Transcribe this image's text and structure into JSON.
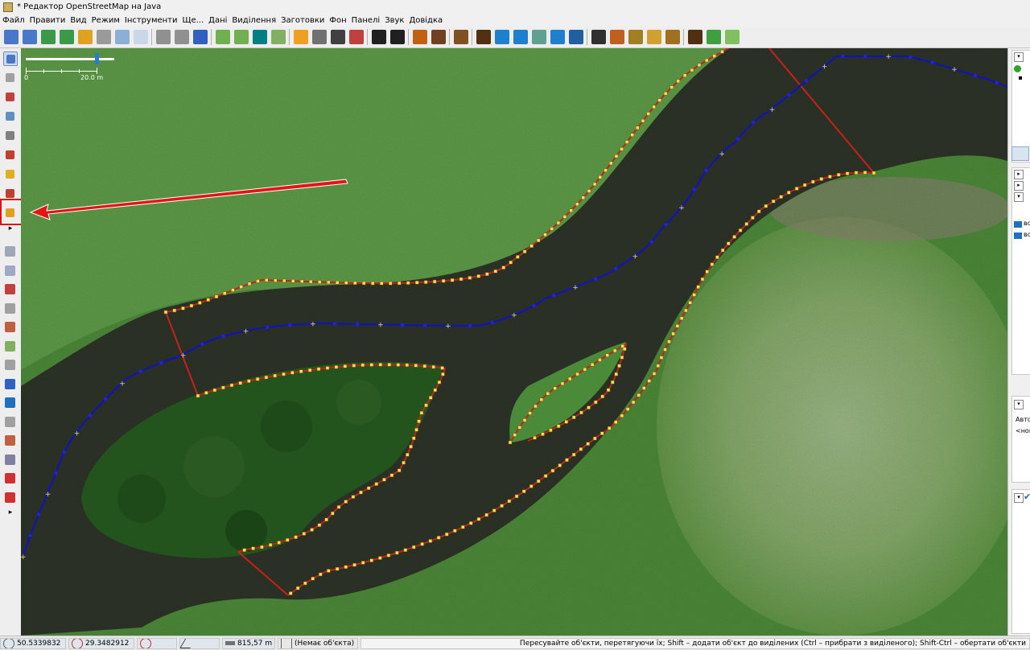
{
  "window": {
    "title": "* Редактор OpenStreetMap на Java"
  },
  "menu": [
    "Файл",
    "Правити",
    "Вид",
    "Режим",
    "Інструменти",
    "Ще...",
    "Дані",
    "Виділення",
    "Заготовки",
    "Фон",
    "Панелі",
    "Звук",
    "Довідка"
  ],
  "toolbar": {
    "icons": [
      "new-layer-icon",
      "open-file-icon",
      "download-icon",
      "upload-icon",
      "undo-icon",
      "redo-icon",
      "zoom-to-selection-icon",
      "preferences-icon",
      "sep",
      "split-way-icon",
      "combine-way-icon",
      "reverse-way-icon",
      "sep",
      "imagery-icon",
      "search-imagery-icon",
      "bing-icon",
      "imagery-offset-icon",
      "sep",
      "road-icon",
      "railway-icon",
      "traffic-signal-icon",
      "barrier-icon",
      "sep",
      "car-icon",
      "bus-icon",
      "sep",
      "warning-icon",
      "restaurant-icon",
      "sep",
      "castle-icon",
      "sep",
      "industrial-icon",
      "waterway-icon",
      "river-icon",
      "wetland-icon",
      "water-icon",
      "canal-icon",
      "sep",
      "tractor-icon",
      "embankment-icon",
      "chain-icon",
      "riverbank-icon",
      "cross-icon",
      "sep",
      "factory-icon",
      "landuse-icon",
      "meadow-icon"
    ],
    "colors": {
      "new-layer-icon": "#4a78c8",
      "open-file-icon": "#4a78c8",
      "download-icon": "#3a9a4a",
      "upload-icon": "#3a9a4a",
      "undo-icon": "#e0a020",
      "redo-icon": "#9a9a9a",
      "zoom-to-selection-icon": "#8ab0d8",
      "preferences-icon": "#c8d8e8",
      "split-way-icon": "#909090",
      "combine-way-icon": "#909090",
      "reverse-way-icon": "#3060c0",
      "imagery-icon": "#70b050",
      "search-imagery-icon": "#70b050",
      "bing-icon": "#008080",
      "imagery-offset-icon": "#80b060",
      "road-icon": "#f0a020",
      "railway-icon": "#707070",
      "traffic-signal-icon": "#404040",
      "barrier-icon": "#c04040",
      "car-icon": "#202020",
      "bus-icon": "#202020",
      "warning-icon": "#c06010",
      "restaurant-icon": "#704020",
      "castle-icon": "#805020",
      "industrial-icon": "#503010",
      "waterway-icon": "#2080d0",
      "river-icon": "#2080d0",
      "wetland-icon": "#60a090",
      "water-icon": "#2080d0",
      "canal-icon": "#2060a0",
      "tractor-icon": "#303030",
      "embankment-icon": "#c06020",
      "chain-icon": "#a08020",
      "riverbank-icon": "#d0a030",
      "cross-icon": "#a07020",
      "factory-icon": "#503010",
      "landuse-icon": "#40a040",
      "meadow-icon": "#80c060"
    }
  },
  "left_tools": [
    {
      "name": "select-tool-icon",
      "color": "#4a78c8",
      "selected": true
    },
    {
      "name": "lasso-tool-icon",
      "color": "#a0a0a0",
      "selected": false
    },
    {
      "name": "draw-line-tool-icon",
      "color": "#c04040",
      "selected": false
    },
    {
      "name": "zoom-tool-icon",
      "color": "#6090c0",
      "selected": false
    },
    {
      "name": "delete-tool-icon",
      "color": "#808080",
      "selected": false
    },
    {
      "name": "improve-way-tool-icon",
      "color": "#c04030",
      "selected": false
    },
    {
      "name": "parallel-way-tool-icon",
      "color": "#e0b020",
      "selected": false
    },
    {
      "name": "extrude-tool-icon",
      "color": "#c04030",
      "selected": false
    },
    {
      "name": "pencil-tool-icon",
      "color": "#e0a020",
      "selected": false
    }
  ],
  "left_panels": [
    {
      "name": "layers-panel-icon",
      "color": "#a0a8b8"
    },
    {
      "name": "tags-panel-icon",
      "color": "#a0a8c8"
    },
    {
      "name": "selection-panel-icon",
      "color": "#c04040"
    },
    {
      "name": "relations-panel-icon",
      "color": "#a0a0a0"
    },
    {
      "name": "history-panel-icon",
      "color": "#c06040"
    },
    {
      "name": "imagery-panel-icon",
      "color": "#80b060"
    },
    {
      "name": "notes-panel-icon",
      "color": "#a0a0a0"
    },
    {
      "name": "conflict-panel-icon",
      "color": "#3060c0"
    },
    {
      "name": "validation-panel-icon",
      "color": "#2070c0"
    },
    {
      "name": "filter-panel-icon",
      "color": "#a0a0a0"
    },
    {
      "name": "plugins-panel-icon",
      "color": "#c06040"
    },
    {
      "name": "style-panel-icon",
      "color": "#8080a0"
    },
    {
      "name": "map-marker-panel-icon",
      "color": "#d03030"
    },
    {
      "name": "changeset-panel-icon",
      "color": "#d03030"
    }
  ],
  "scale": {
    "zero": "0",
    "distance": "20.0 m"
  },
  "right_panel": {
    "text1": "во",
    "text2": "во",
    "text3": "Авто",
    "text4": "<нов"
  },
  "status": {
    "lat": "50.5339832",
    "lon": "29.3482912",
    "length": "815,57 m",
    "object": "(Немає об'єкта)",
    "hint": "Пересувайте об'єкти, перетягуючи їх; Shift – додати об'єкт до виділених (Ctrl – прибрати з виділеного); Shift-Ctrl – обертати об'єкти"
  },
  "map_colors": {
    "grass": "#4d8a3a",
    "field": "#5e9c48",
    "river": "#2e3428",
    "outline": "#c8201e",
    "waterway": "#1010c8",
    "node": "#f0e060",
    "tree": "#24541e"
  }
}
